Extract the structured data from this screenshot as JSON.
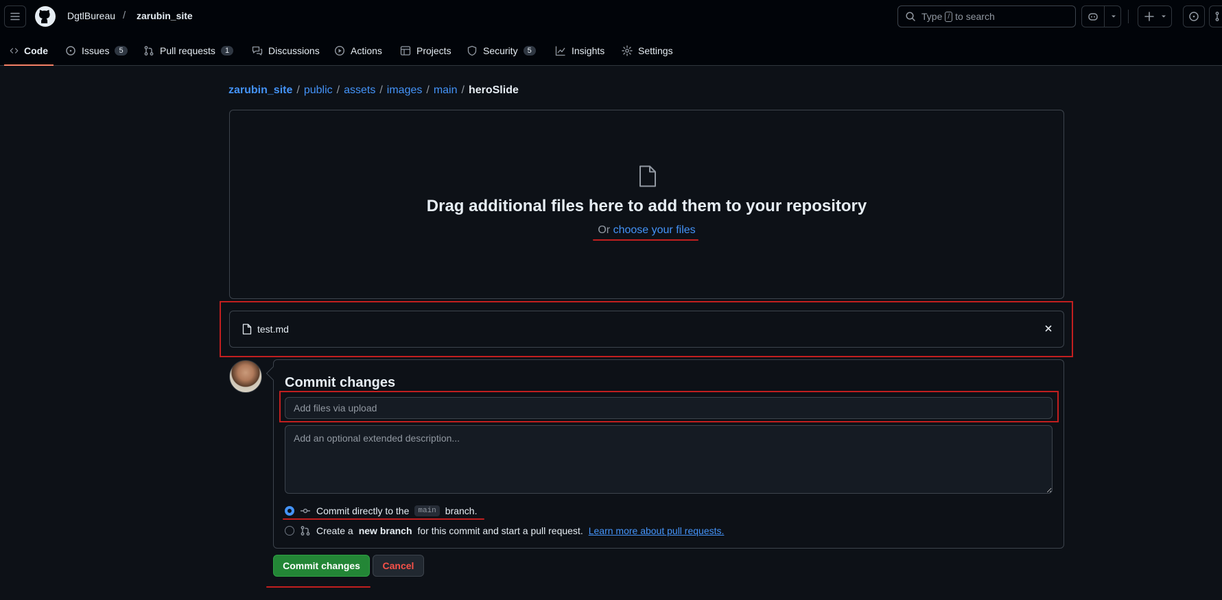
{
  "header": {
    "owner": "DgtlBureau",
    "separator": "/",
    "repo": "zarubin_site",
    "search_prefix": "Type",
    "search_key": "/",
    "search_suffix": "to search"
  },
  "tabs": [
    {
      "label": "Code",
      "icon": "code-icon",
      "selected": true
    },
    {
      "label": "Issues",
      "icon": "issue-icon",
      "count": "5"
    },
    {
      "label": "Pull requests",
      "icon": "pull-request-icon",
      "count": "1"
    },
    {
      "label": "Discussions",
      "icon": "discussion-icon"
    },
    {
      "label": "Actions",
      "icon": "play-icon"
    },
    {
      "label": "Projects",
      "icon": "table-icon"
    },
    {
      "label": "Security",
      "icon": "shield-icon",
      "count": "5"
    },
    {
      "label": "Insights",
      "icon": "graph-icon"
    },
    {
      "label": "Settings",
      "icon": "gear-icon"
    }
  ],
  "breadcrumb": {
    "items": [
      "zarubin_site",
      "public",
      "assets",
      "images",
      "main"
    ],
    "separator": "/",
    "current": "heroSlide"
  },
  "dropzone": {
    "title": "Drag additional files here to add them to your repository",
    "or_text": "Or",
    "choose_link": "choose your files"
  },
  "uploaded_file": {
    "name": "test.md"
  },
  "commit": {
    "title": "Commit changes",
    "summary_placeholder": "Add files via upload",
    "description_placeholder": "Add an optional extended description...",
    "option_direct": {
      "before": "Commit directly to the",
      "branch": "main",
      "after": "branch."
    },
    "option_new_branch": {
      "before": "Create a",
      "bold": "new branch",
      "after": "for this commit and start a pull request.",
      "link": "Learn more about pull requests."
    },
    "submit_label": "Commit changes",
    "cancel_label": "Cancel"
  },
  "colors": {
    "background": "#0d1117",
    "accent_link": "#4493f8",
    "primary_button": "#238636",
    "danger_text": "#f85149",
    "annotation_red": "#c21f1f",
    "selected_tab_underline": "#f78166"
  }
}
